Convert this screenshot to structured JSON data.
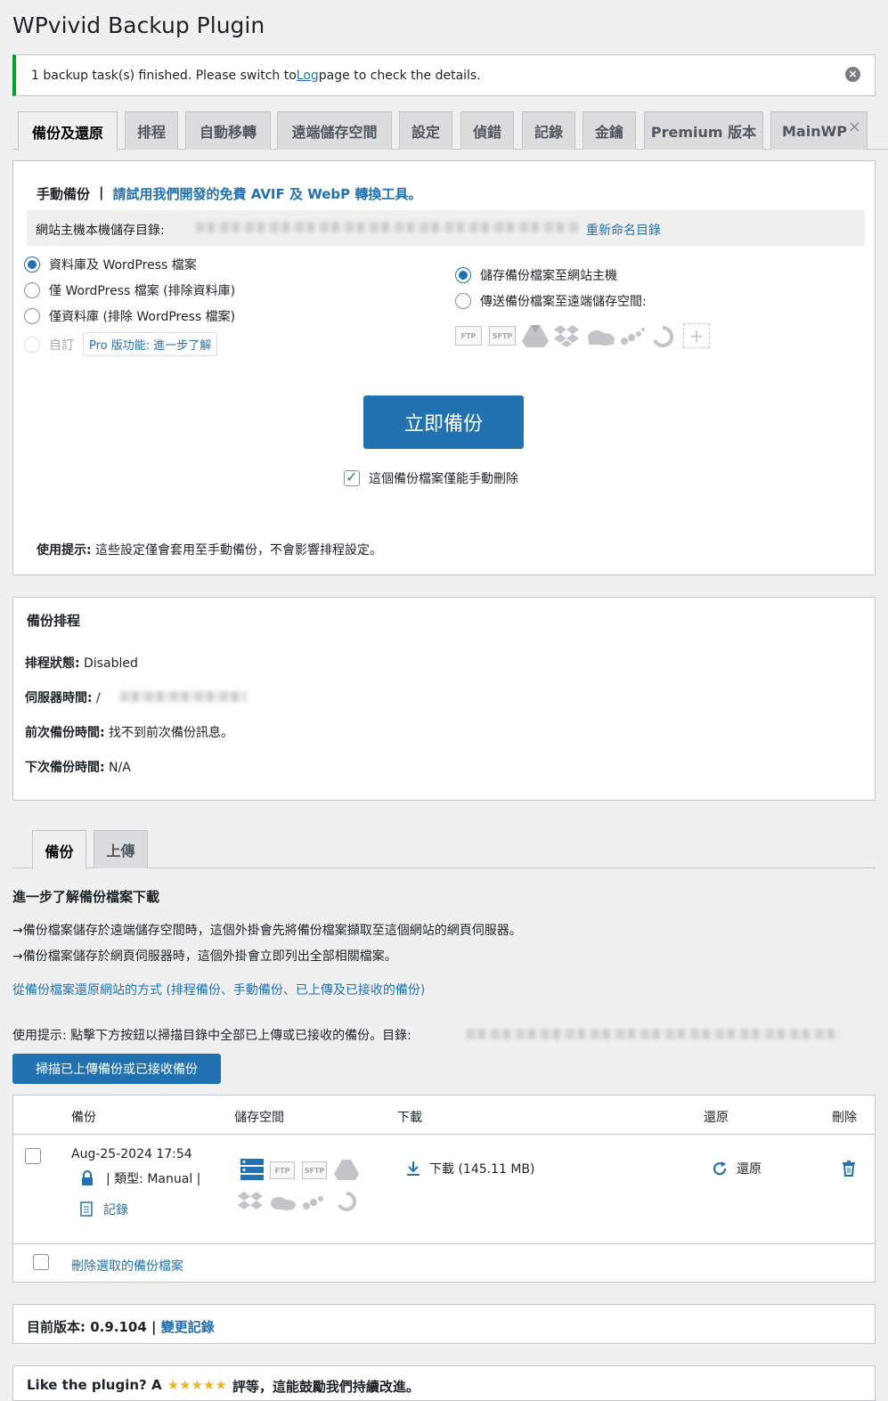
{
  "page": {
    "title": "WPvivid Backup Plugin"
  },
  "notice": {
    "text_before": "1 backup task(s) finished. Please switch to ",
    "link": "Log",
    "text_after": " page to check the details."
  },
  "tabs": [
    {
      "label": "備份及還原"
    },
    {
      "label": "排程"
    },
    {
      "label": "自動移轉"
    },
    {
      "label": "遠端儲存空間"
    },
    {
      "label": "設定"
    },
    {
      "label": "偵錯"
    },
    {
      "label": "記錄"
    },
    {
      "label": "金鑰"
    },
    {
      "label": "Premium 版本"
    },
    {
      "label": "MainWP"
    }
  ],
  "manual": {
    "heading": "手動備份",
    "separator": "|",
    "promo_link": "請試用我們開發的免費 AVIF 及 WebP 轉換工具。",
    "dir_label": "網站主機本機儲存目錄:",
    "rename_link": "重新命名目錄",
    "options": [
      {
        "label": "資料庫及 WordPress 檔案"
      },
      {
        "label": "僅 WordPress 檔案 (排除資料庫)"
      },
      {
        "label": "僅資料庫 (排除 WordPress 檔案)"
      },
      {
        "label": "自訂"
      }
    ],
    "pro_badge": "Pro 版功能: 進一步了解",
    "dest_options": [
      {
        "label": "儲存備份檔案至網站主機"
      },
      {
        "label": "傳送備份檔案至遠端儲存空間:"
      }
    ],
    "storage_icons": [
      "ftp-icon",
      "sftp-icon",
      "google-drive-icon",
      "dropbox-icon",
      "onedrive-icon",
      "s3-icon",
      "wasabi-icon",
      "add-storage-icon"
    ],
    "storage_text": {
      "ftp": "FTP",
      "sftp": "SFTP"
    },
    "backup_button": "立即備份",
    "manual_delete_label": "這個備份檔案僅能手動刪除",
    "tip_label": "使用提示:",
    "tip_text": " 這些設定僅會套用至手動備份，不會影響排程設定。"
  },
  "schedule": {
    "title": "備份排程",
    "rows": [
      {
        "label": "排程狀態:",
        "value": " Disabled"
      },
      {
        "label": "伺服器時間:",
        "value": " /"
      },
      {
        "label": "前次備份時間:",
        "value": " 找不到前次備份訊息。"
      },
      {
        "label": "下次備份時間:",
        "value": " N/A"
      }
    ]
  },
  "backups": {
    "tabs": [
      {
        "label": "備份"
      },
      {
        "label": "上傳"
      }
    ],
    "heading": "進一步了解備份檔案下載",
    "line1": "→備份檔案儲存於遠端儲存空間時，這個外掛會先將備份檔案擷取至這個網站的網頁伺服器。",
    "line2": "→備份檔案儲存於網頁伺服器時，這個外掛會立即列出全部相關檔案。",
    "restore_link": "從備份檔案還原網站的方式 (排程備份、手動備份、已上傳及已接收的備份)",
    "scan_tip": "使用提示: 點擊下方按鈕以掃描目錄中全部已上傳或已接收的備份。目錄:",
    "scan_button": "掃描已上傳備份或已接收備份",
    "columns": {
      "backup": "備份",
      "storage": "儲存空間",
      "download": "下載",
      "restore": "還原",
      "delete": "刪除"
    },
    "row": {
      "date": "Aug-25-2024 17:54",
      "type_text": "| 類型: Manual |",
      "log_link": "記錄",
      "download": "下載 (145.11 MB)",
      "restore": "還原"
    },
    "delete_selected": "刪除選取的備份檔案"
  },
  "footer": {
    "version_label": "目前版本: 0.9.104",
    "separator": " | ",
    "changelog": "變更記錄",
    "like_text_before": "Like the plugin? A",
    "stars": "★★★★★",
    "like_text_after": "評等，這能鼓勵我們持續改進。"
  },
  "colors": {
    "accent": "#2271b1",
    "success": "#00a32a",
    "background": "#f0f0f1",
    "star": "#f0b429"
  }
}
